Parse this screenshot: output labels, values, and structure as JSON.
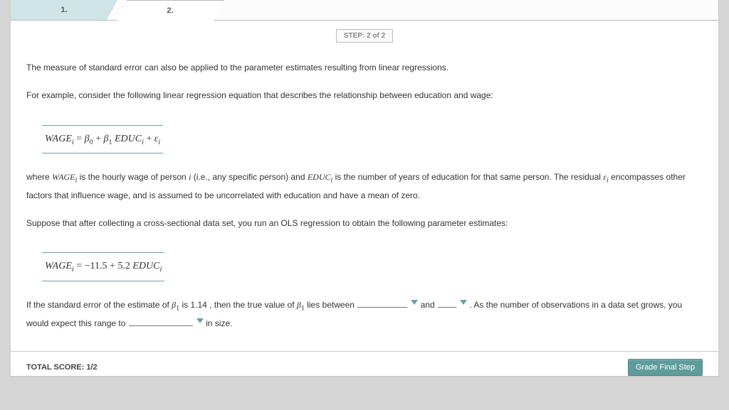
{
  "tabs": {
    "prev": "1.",
    "cur": "2."
  },
  "step": {
    "label": "STEP: 2 of 2"
  },
  "text": {
    "p1": "The measure of standard error can also be applied to the parameter estimates resulting from linear regressions.",
    "p2": "For example, consider the following linear regression equation that describes the relationship between education and wage:",
    "p3a": "where ",
    "p3b": " is the hourly wage of person ",
    "p3c": " (i.e., any specific person) and ",
    "p3d": " is the number of years of education for that same person. The residual ",
    "p3e": " encompasses other factors that influence wage, and is assumed to be uncorrelated with education and have a mean of zero.",
    "p4": "Suppose that after collecting a cross-sectional data set, you run an OLS regression to obtain the following parameter estimates:",
    "q1a": "If the standard error of the estimate of ",
    "q1b": " is ",
    "q1c": ", then the true value of ",
    "q1d": " lies between ",
    "and": " and ",
    "q1e": " . As the number of observations in a data set grows, you would expect this range to ",
    "q1f": "  in size."
  },
  "estimates": {
    "b0": "−11.5",
    "b1": "5.2",
    "se": "1.14"
  },
  "footer": {
    "score_label": "TOTAL SCORE: ",
    "score_value": "1/2",
    "grade_btn": "Grade Final Step"
  }
}
